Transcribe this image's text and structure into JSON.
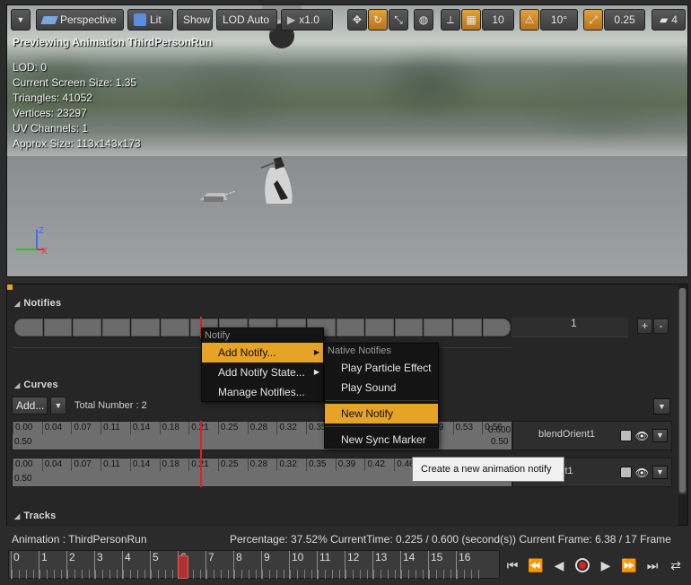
{
  "viewport": {
    "toolbar": {
      "perspective": "Perspective",
      "lit": "Lit",
      "show": "Show",
      "lod": "LOD Auto",
      "speed": "x1.0",
      "grid_size": "10",
      "rotation_snap": "10°",
      "scale_snap": "0.25",
      "camera_speed": "4"
    },
    "title": "Previewing Animation ThirdPersonRun",
    "stats": [
      "LOD: 0",
      "Current Screen Size: 1.35",
      "Triangles: 41052",
      "Vertices: 23297",
      "UV Channels: 1",
      "Approx Size: 113x143x173"
    ],
    "axis_z": "Z",
    "axis_x": "X"
  },
  "notifies": {
    "header": "Notifies",
    "track_number": "1",
    "plus": "+",
    "minus": "-"
  },
  "curves": {
    "header": "Curves",
    "add_label": "Add...",
    "total": "Total Number : 2",
    "ticks": [
      "0.00",
      "0.04",
      "0.07",
      "0.11",
      "0.14",
      "0.18",
      "0.21",
      "0.25",
      "0.28",
      "0.32",
      "0.35",
      "0.39",
      "0.42",
      "0.46",
      "0.49",
      "0.53",
      "0.56"
    ],
    "row1_end": "0.600",
    "value_label": "0.50",
    "rows": [
      {
        "name": "blendOrient1"
      },
      {
        "name": "Parent1"
      }
    ]
  },
  "tracks": {
    "header": "Tracks"
  },
  "menus": {
    "notify": {
      "header": "Notify",
      "items": [
        "Add Notify...",
        "Add Notify State...",
        "Manage Notifies..."
      ]
    },
    "submenu": {
      "header": "Native Notifies",
      "items": [
        "Play Particle Effect",
        "Play Sound"
      ],
      "new_notify": "New Notify",
      "new_sync": "New Sync Marker"
    },
    "tooltip": "Create a new animation notify"
  },
  "status": {
    "animation": "Animation :  ThirdPersonRun",
    "percentage": "Percentage:  37.52% CurrentTime:  0.225 / 0.600 (second(s)) Current Frame:  6.38 / 17 Frame"
  },
  "timeline": {
    "frames": [
      "0",
      "1",
      "2",
      "3",
      "4",
      "5",
      "6",
      "7",
      "8",
      "9",
      "10",
      "11",
      "12",
      "13",
      "14",
      "15",
      "16"
    ],
    "current_frame": 6.38
  },
  "colors": {
    "accent": "#e6a325",
    "playhead": "#e02020"
  }
}
